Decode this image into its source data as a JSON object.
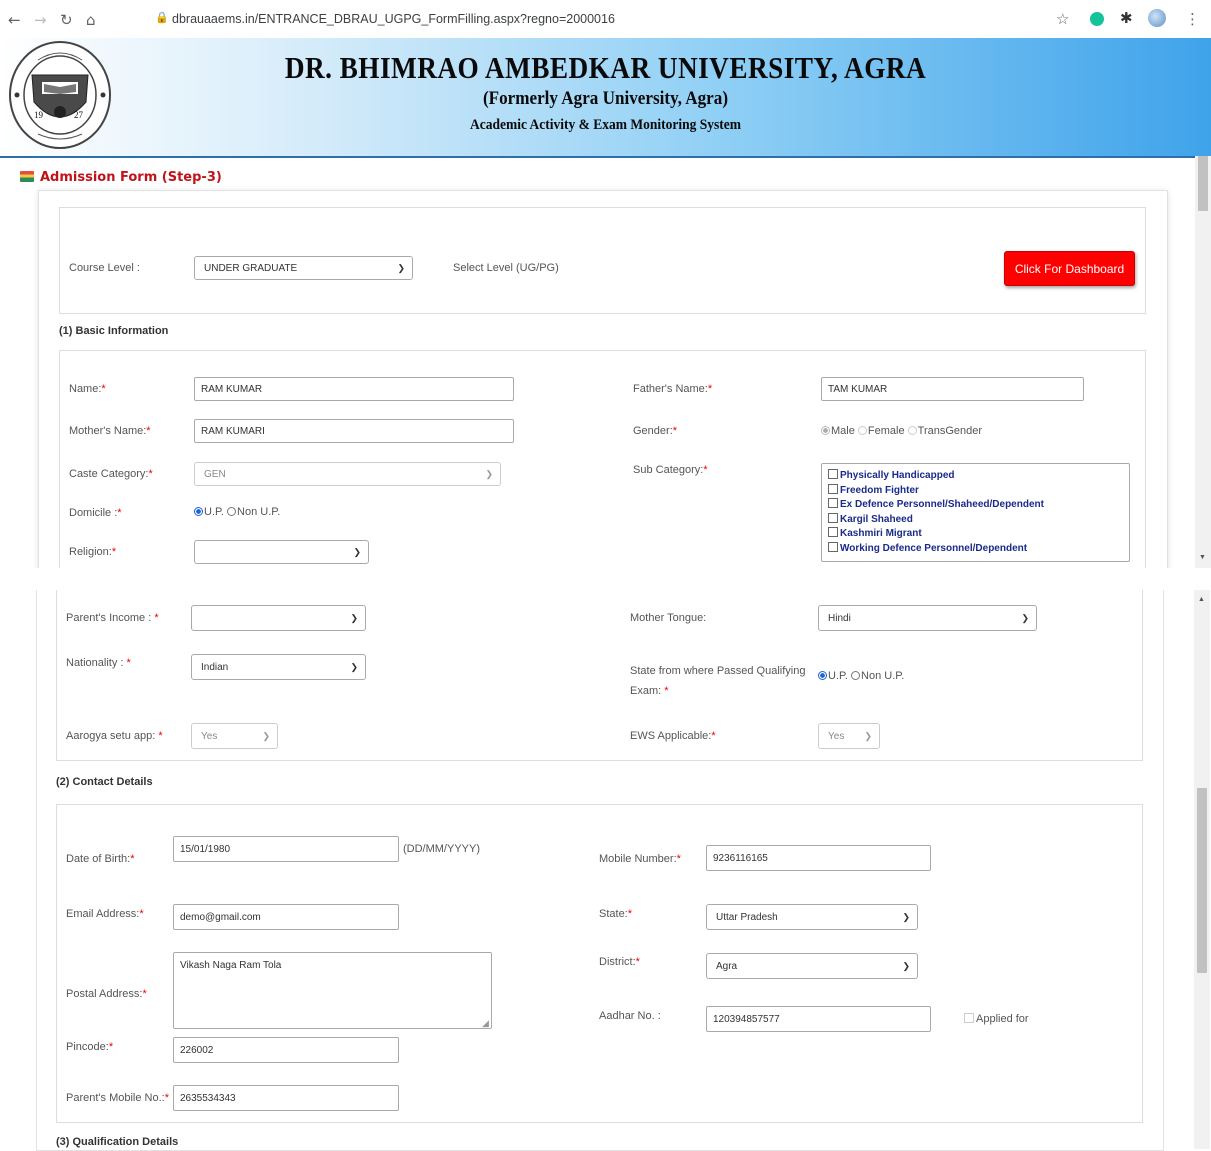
{
  "browser": {
    "url": "dbrauaaems.in/ENTRANCE_DBRAU_UGPG_FormFilling.aspx?regno=2000016"
  },
  "header": {
    "title": "DR. BHIMRAO AMBEDKAR UNIVERSITY, AGRA",
    "subtitle": "(Formerly Agra University, Agra)",
    "system": "Academic Activity & Exam Monitoring System",
    "logo_year_left": "19",
    "logo_year_right": "27"
  },
  "form": {
    "title": "Admission Form (Step-3)",
    "course_level_label": "Course Level :",
    "course_level_value": "UNDER GRADUATE",
    "select_level_hint": "Select Level (UG/PG)",
    "dashboard_button": "Click For Dashboard"
  },
  "basic": {
    "section": "(1) Basic Information",
    "name_label": "Name:",
    "name_value": "RAM KUMAR",
    "father_label": "Father's Name:",
    "father_value": "TAM KUMAR",
    "mother_label": "Mother's Name:",
    "mother_value": "RAM KUMARI",
    "gender_label": "Gender:",
    "gender_options": [
      "Male",
      "Female",
      "TransGender"
    ],
    "caste_label": "Caste Category:",
    "caste_value": "GEN",
    "subcat_label": "Sub Category:",
    "subcat_options": [
      "Physically Handicapped",
      "Freedom Fighter",
      "Ex Defence Personnel/Shaheed/Dependent",
      "Kargil Shaheed",
      "Kashmiri Migrant",
      "Working Defence Personnel/Dependent"
    ],
    "domicile_label": "Domicile :",
    "domicile_options": [
      "U.P.",
      "Non U.P."
    ],
    "religion_label": "Religion:",
    "religion_value": "",
    "income_label": "Parent's Income : ",
    "income_value": "",
    "mother_tongue_label": "Mother Tongue:",
    "mother_tongue_value": "Hindi",
    "nationality_label": "Nationality : ",
    "nationality_value": "Indian",
    "state_passed_label_1": "State from where Passed Qualifying",
    "state_passed_label_2": "Exam: ",
    "state_passed_options": [
      "U.P.",
      "Non U.P."
    ],
    "aarogya_label": "Aarogya setu app: ",
    "aarogya_value": "Yes",
    "ews_label": "EWS Applicable:",
    "ews_value": "Yes"
  },
  "contact": {
    "section": "(2) Contact Details",
    "dob_label": "Date of Birth:",
    "dob_value": "15/01/1980",
    "dob_hint": "(DD/MM/YYYY)",
    "mobile_label": "Mobile Number:",
    "mobile_value": "9236116165",
    "email_label": "Email Address:",
    "email_value": "demo@gmail.com",
    "state_label": "State:",
    "state_value": "Uttar Pradesh",
    "postal_label": "Postal Address:",
    "postal_value": "Vikash Naga Ram Tola",
    "district_label": "District:",
    "district_value": "Agra",
    "aadhar_label": "Aadhar No. :",
    "aadhar_value": "120394857577",
    "applied_for_label": "Applied for",
    "pincode_label": "Pincode:",
    "pincode_value": "226002",
    "parent_mobile_label": "Parent's Mobile No.:",
    "parent_mobile_value": "2635534343"
  },
  "qualification": {
    "section": "(3) Qualification Details"
  },
  "colors": {
    "required": "#ee0000",
    "dashboard_button": "#ff0000",
    "form_title": "#c0141b",
    "subcat_text": "#1a2a88"
  }
}
